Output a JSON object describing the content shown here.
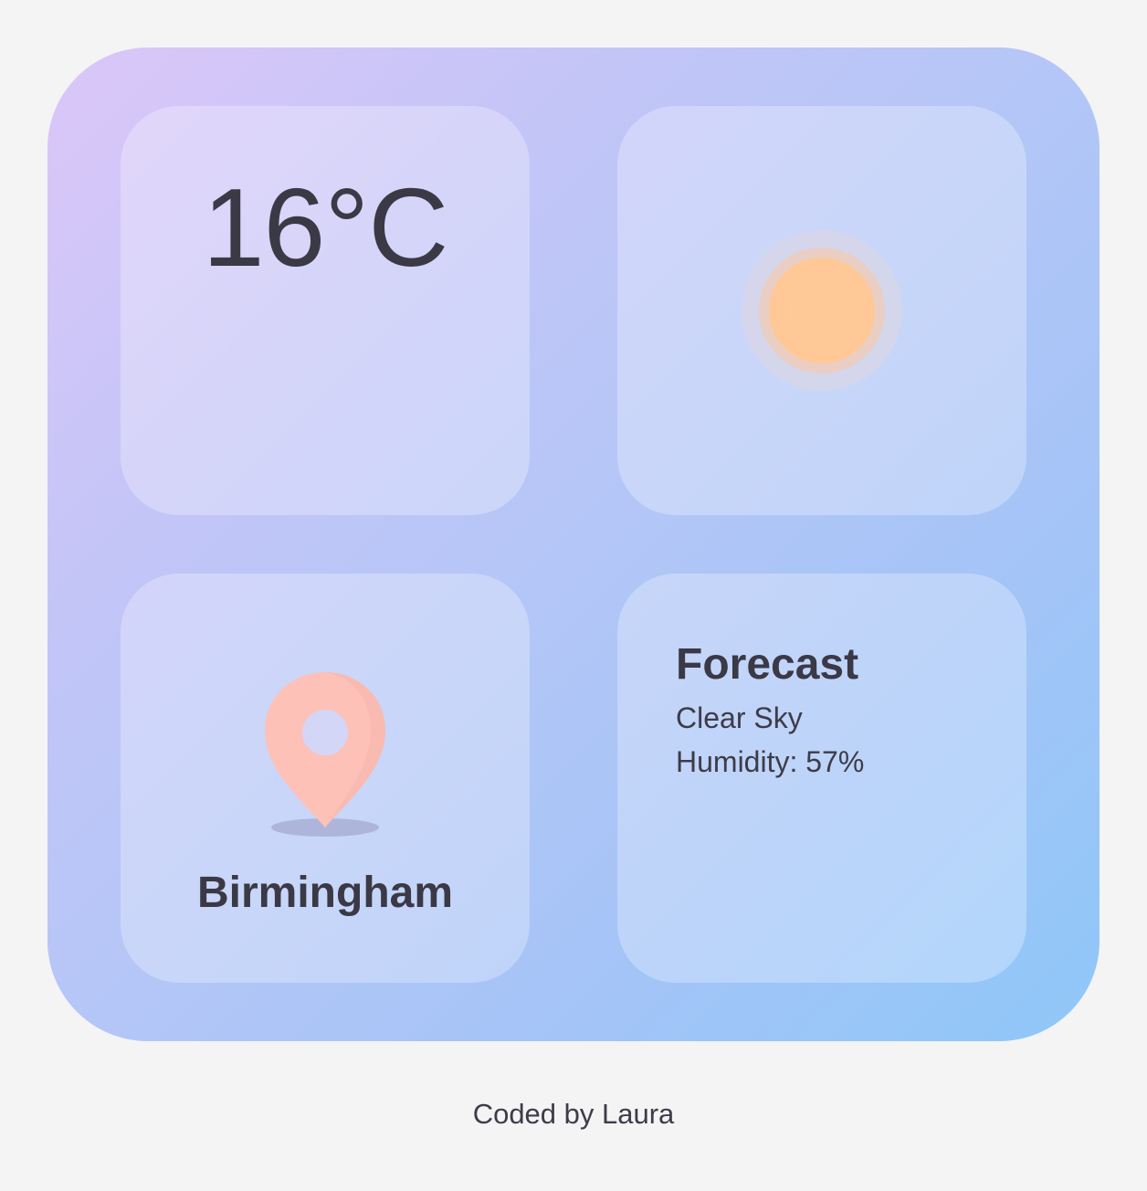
{
  "weather": {
    "temperature": "16°C",
    "condition_icon": "sun-icon",
    "location_icon": "map-pin-icon",
    "city": "Birmingham",
    "forecast": {
      "title": "Forecast",
      "condition": "Clear Sky",
      "humidity": "Humidity: 57%"
    }
  },
  "footer": {
    "credit": "Coded by Laura"
  },
  "colors": {
    "sun": "#ffc896",
    "pin": "#ffc4bb",
    "text": "#3a3945",
    "gradient_start": "#dcc6f8",
    "gradient_end": "#8fc7f8"
  }
}
